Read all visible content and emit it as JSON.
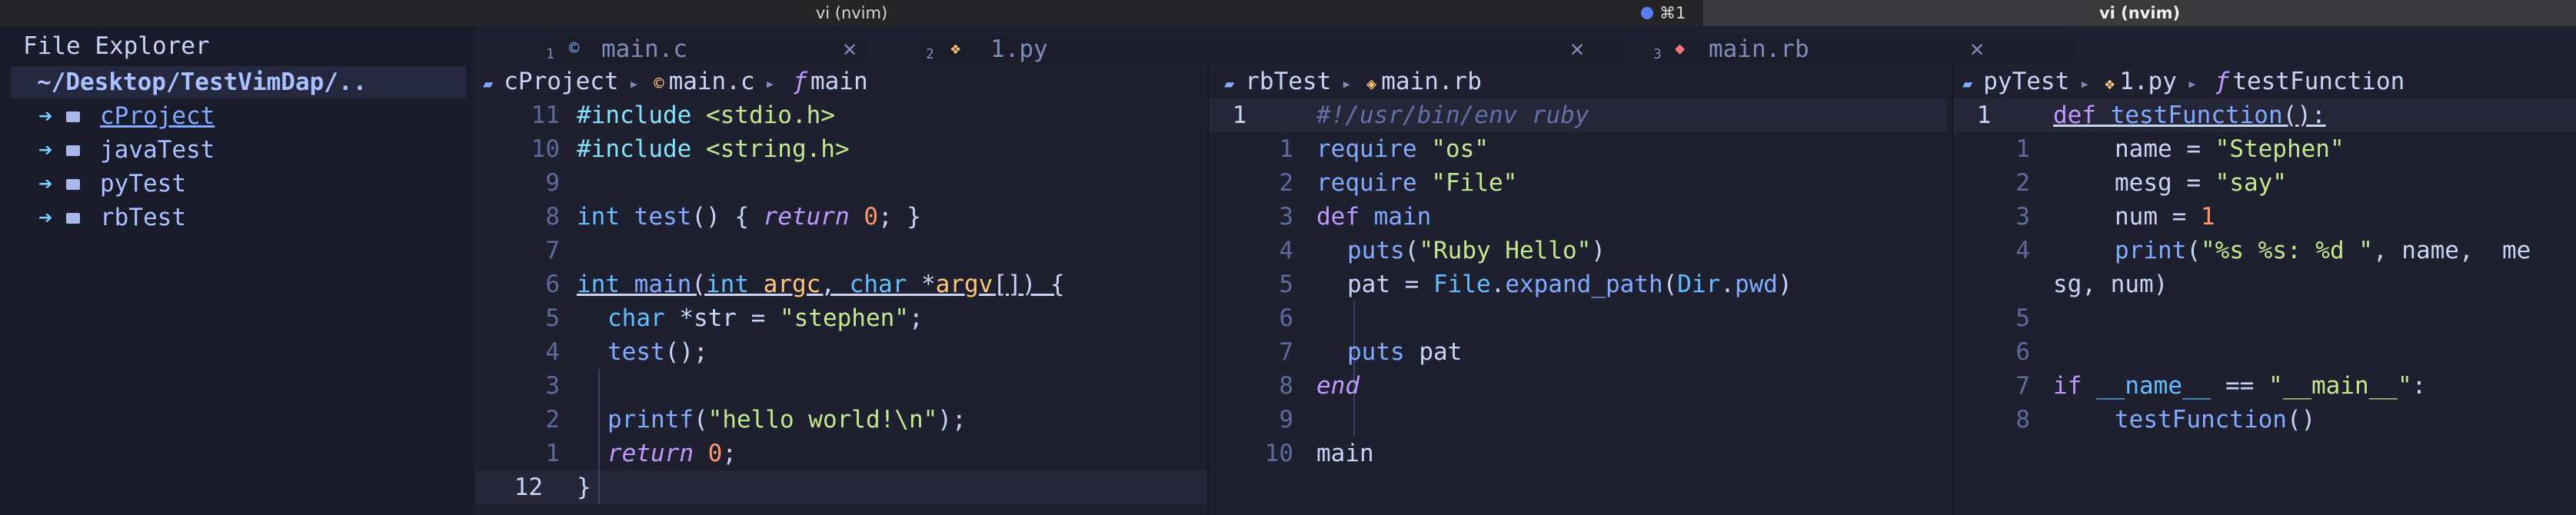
{
  "titlebar": {
    "tab1_title": "vi (nvim)",
    "tab2_title": "vi (nvim)",
    "shortcut": "⌘1",
    "dot_color": "#5b7cf6"
  },
  "explorer": {
    "title": "File Explorer",
    "root": "~/Desktop/TestVimDap/..",
    "items": [
      {
        "label": "cProject",
        "icon": "folder-icon"
      },
      {
        "label": "javaTest",
        "icon": "folder-icon"
      },
      {
        "label": "pyTest",
        "icon": "folder-icon"
      },
      {
        "label": "rbTest",
        "icon": "folder-icon"
      }
    ]
  },
  "tabs": [
    {
      "num": "1",
      "name": "main.c",
      "icon": "c-file-icon"
    },
    {
      "num": "2",
      "name": "1.py",
      "icon": "python-file-icon"
    },
    {
      "num": "3",
      "name": "main.rb",
      "icon": "ruby-file-icon"
    }
  ],
  "close_glyph": "✕",
  "panes": [
    {
      "crumb": {
        "dir": "cProject",
        "file": "main.c",
        "symbol": "main"
      },
      "lines": [
        {
          "n": "11"
        },
        {
          "n": "10"
        },
        {
          "n": "9"
        },
        {
          "n": "8"
        },
        {
          "n": "7"
        },
        {
          "n": "6"
        },
        {
          "n": "5"
        },
        {
          "n": "4"
        },
        {
          "n": "3"
        },
        {
          "n": "2"
        },
        {
          "n": "1"
        },
        {
          "n": "12"
        }
      ]
    },
    {
      "crumb": {
        "dir": "rbTest",
        "file": "main.rb"
      },
      "lines": [
        {
          "n": "1"
        },
        {
          "n": "1"
        },
        {
          "n": "2"
        },
        {
          "n": "3"
        },
        {
          "n": "4"
        },
        {
          "n": "5"
        },
        {
          "n": "6"
        },
        {
          "n": "7"
        },
        {
          "n": "8"
        },
        {
          "n": "9"
        },
        {
          "n": "10"
        }
      ]
    },
    {
      "crumb": {
        "dir": "pyTest",
        "file": "1.py",
        "symbol": "testFunction"
      },
      "lines": [
        {
          "n": "1"
        },
        {
          "n": "1"
        },
        {
          "n": "2"
        },
        {
          "n": "3"
        },
        {
          "n": "4"
        },
        {
          "n": ""
        },
        {
          "n": "5"
        },
        {
          "n": "6"
        },
        {
          "n": "7"
        },
        {
          "n": "8"
        }
      ]
    }
  ]
}
